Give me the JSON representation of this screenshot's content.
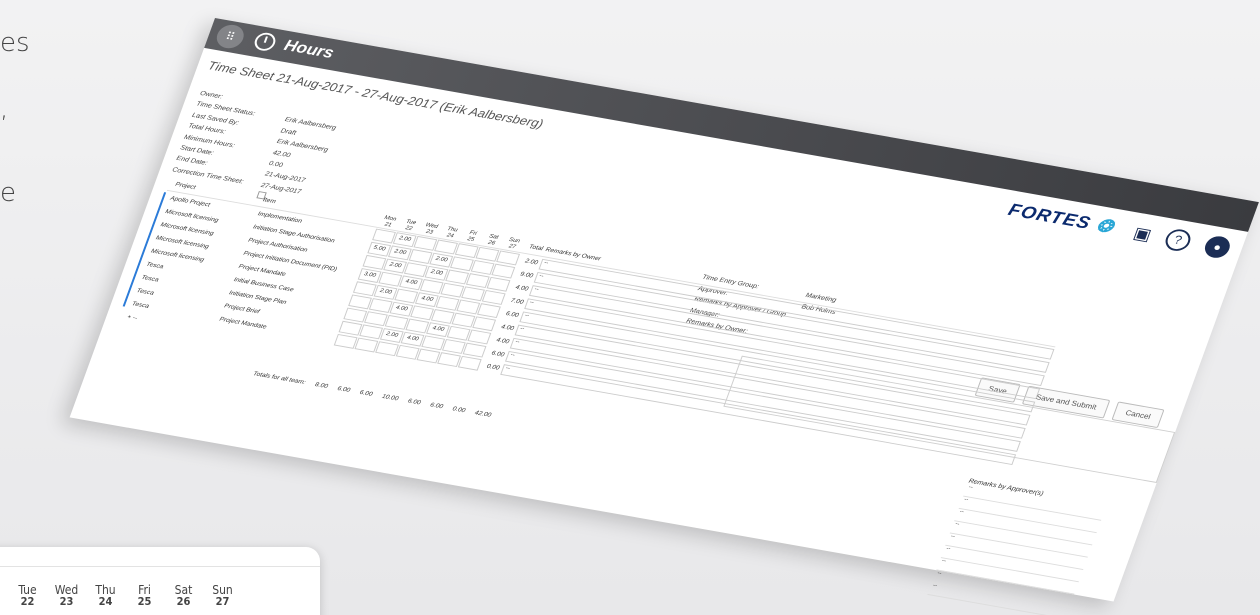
{
  "side_text": [
    "es",
    ",",
    "e"
  ],
  "header": {
    "title": "Hours",
    "logo": "FORTES"
  },
  "sheet_title": "Time Sheet 21-Aug-2017 - 27-Aug-2017 (Erik Aalbersberg)",
  "meta": [
    {
      "label": "Owner:",
      "value": ""
    },
    {
      "label": "Time Sheet Status:",
      "value": "Erik Aalbersberg"
    },
    {
      "label": "Last Saved By:",
      "value": "Draft"
    },
    {
      "label": "Total Hours:",
      "value": "Erik Aalbersberg"
    },
    {
      "label": "Minimum Hours:",
      "value": "42.00"
    },
    {
      "label": "Start Date:",
      "value": "0.00"
    },
    {
      "label": "End Date:",
      "value": "21-Aug-2017"
    },
    {
      "label": "Correction Time Sheet:",
      "value": "27-Aug-2017"
    }
  ],
  "right_meta": [
    {
      "label": "Time Entry Group:",
      "value": "Marketing"
    },
    {
      "label": "Approver:",
      "value": "Bob Holms"
    },
    {
      "label": "Remarks by Approver / Group Manager:",
      "value": ""
    },
    {
      "label": "Remarks by Owner:",
      "value": ""
    }
  ],
  "buttons": {
    "save": "Save",
    "save_submit": "Save and Submit",
    "cancel": "Cancel"
  },
  "grid": {
    "headers": {
      "project": "Project",
      "item": "Item",
      "total": "Total",
      "remarks": "Remarks by Owner"
    },
    "days": [
      {
        "name": "Mon",
        "num": "21"
      },
      {
        "name": "Tue",
        "num": "22"
      },
      {
        "name": "Wed",
        "num": "23"
      },
      {
        "name": "Thu",
        "num": "24"
      },
      {
        "name": "Fri",
        "num": "25"
      },
      {
        "name": "Sat",
        "num": "26"
      },
      {
        "name": "Sun",
        "num": "27"
      }
    ],
    "rows": [
      {
        "project": "Apollo Project",
        "item": "Implementation",
        "hours": [
          "",
          "2.00",
          "",
          "",
          "",
          "",
          ""
        ],
        "total": "2.00",
        "remark": "--"
      },
      {
        "project": "Microsoft licensing",
        "item": "Initiation Stage Authorisation",
        "hours": [
          "5.00",
          "2.00",
          "",
          "2.00",
          "",
          "",
          ""
        ],
        "total": "9.00",
        "remark": "--"
      },
      {
        "project": "Microsoft licensing",
        "item": "Project Authorisation",
        "hours": [
          "",
          "2.00",
          "",
          "2.00",
          "",
          "",
          ""
        ],
        "total": "4.00",
        "remark": "--"
      },
      {
        "project": "Microsoft licensing",
        "item": "Project Initiation Document (PID)",
        "hours": [
          "3.00",
          "",
          "4.00",
          "",
          "",
          "",
          ""
        ],
        "total": "7.00",
        "remark": "--"
      },
      {
        "project": "Microsoft licensing",
        "item": "Project Mandate",
        "hours": [
          "",
          "2.00",
          "",
          "4.00",
          "",
          "",
          ""
        ],
        "total": "6.00",
        "remark": "--"
      },
      {
        "project": "Tesca",
        "item": "Initial Business Case",
        "hours": [
          "",
          "",
          "4.00",
          "",
          "",
          "",
          ""
        ],
        "total": "4.00",
        "remark": "--"
      },
      {
        "project": "Tesca",
        "item": "Initiation Stage Plan",
        "hours": [
          "",
          "",
          "",
          "",
          "4.00",
          "",
          ""
        ],
        "total": "4.00",
        "remark": "--"
      },
      {
        "project": "Tesca",
        "item": "Project Brief",
        "hours": [
          "",
          "",
          "2.00",
          "4.00",
          "",
          "",
          ""
        ],
        "total": "6.00",
        "remark": "--"
      },
      {
        "project": "Tesca",
        "item": "Project Mandate",
        "hours": [
          "",
          "",
          "",
          "",
          "",
          "",
          ""
        ],
        "total": "0.00",
        "remark": "--"
      }
    ],
    "totals_label": "Totals for all team:",
    "totals": [
      "8.00",
      "6.00",
      "6.00",
      "10.00",
      "6.00",
      "6.00",
      "0.00",
      "42.00"
    ]
  },
  "approver_remarks": {
    "title": "Remarks by Approver(s)",
    "rows": [
      "--",
      "--",
      "--",
      "--",
      "--",
      "--",
      "--",
      "--",
      "--"
    ]
  },
  "card": {
    "days": [
      {
        "name": "Tue",
        "num": "22"
      },
      {
        "name": "Wed",
        "num": "23"
      },
      {
        "name": "Thu",
        "num": "24"
      },
      {
        "name": "Fri",
        "num": "25"
      },
      {
        "name": "Sat",
        "num": "26"
      },
      {
        "name": "Sun",
        "num": "27"
      }
    ]
  },
  "icons": [
    "grid-icon",
    "timer-icon",
    "chat-icon",
    "help-icon",
    "user-icon",
    "add-icon"
  ]
}
